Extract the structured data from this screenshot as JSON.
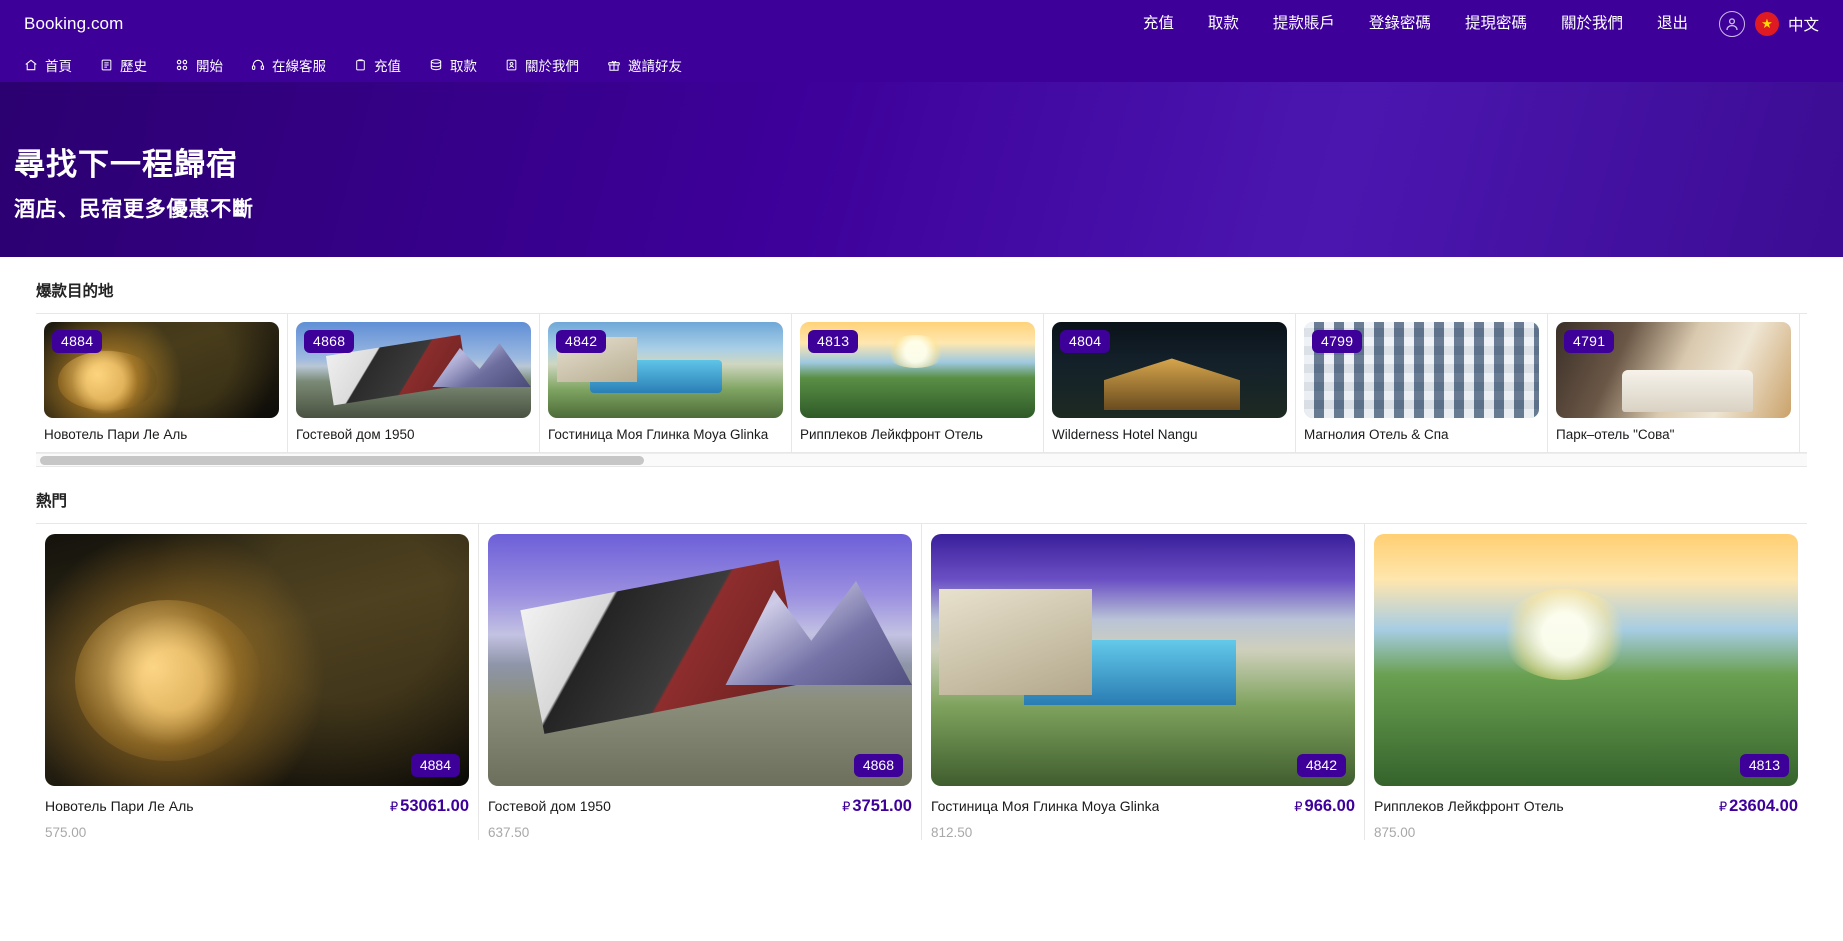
{
  "topbar": {
    "brand": "Booking.com",
    "nav": [
      {
        "label": "充值"
      },
      {
        "label": "取款"
      },
      {
        "label": "提款賬戶"
      },
      {
        "label": "登錄密碼"
      },
      {
        "label": "提現密碼"
      },
      {
        "label": "關於我們"
      },
      {
        "label": "退出"
      }
    ],
    "account_icon": "user-avatar-icon",
    "language": {
      "label": "中文",
      "flag_icon": "china-flag-icon",
      "flag_color": "#e01a22"
    }
  },
  "subnav": {
    "items": [
      {
        "label": "首頁",
        "icon": "home-icon"
      },
      {
        "label": "歷史",
        "icon": "list-icon"
      },
      {
        "label": "開始",
        "icon": "grid-icon"
      },
      {
        "label": "在線客服",
        "icon": "headset-icon"
      },
      {
        "label": "充值",
        "icon": "clipboard-icon"
      },
      {
        "label": "取款",
        "icon": "database-icon"
      },
      {
        "label": "關於我們",
        "icon": "id-card-icon"
      },
      {
        "label": "邀請好友",
        "icon": "gift-icon"
      }
    ]
  },
  "hero": {
    "title": "尋找下一程歸宿",
    "subtitle": "酒店、民宿更多優惠不斷"
  },
  "destinations": {
    "title": "爆款目的地",
    "items": [
      {
        "badge": "4884",
        "name": "Новотель Пари Ле Аль",
        "art": "ph-dome"
      },
      {
        "badge": "4868",
        "name": "Гостевой дом 1950",
        "art": "ph-house"
      },
      {
        "badge": "4842",
        "name": "Гостиница Моя Глинка Moya Glinka",
        "art": "ph-pool"
      },
      {
        "badge": "4813",
        "name": "Рипплеков Лейкфронт Отель",
        "art": "ph-lake"
      },
      {
        "badge": "4804",
        "name": "Wilderness Hotel Nangu",
        "art": "ph-cabin"
      },
      {
        "badge": "4799",
        "name": "Магнолия Отель & Спа",
        "art": "ph-tower"
      },
      {
        "badge": "4791",
        "name": "Парк–отель \"Сова\"",
        "art": "ph-room"
      }
    ]
  },
  "hot": {
    "title": "熱門",
    "currency": "₽",
    "items": [
      {
        "badge": "4884",
        "name": "Новотель Пари Ле Аль",
        "price": "53061.00",
        "sub": "575.00",
        "art": "ph-dome-big"
      },
      {
        "badge": "4868",
        "name": "Гостевой дом 1950",
        "price": "3751.00",
        "sub": "637.50",
        "art": "ph-house-big"
      },
      {
        "badge": "4842",
        "name": "Гостиница Моя Глинка Moya Glinka",
        "price": "966.00",
        "sub": "812.50",
        "art": "ph-pool-big"
      },
      {
        "badge": "4813",
        "name": "Рипплеков Лейкфронт Отель",
        "price": "23604.00",
        "sub": "875.00",
        "art": "ph-lake-big"
      }
    ]
  },
  "colors": {
    "brand_purple": "#3d0099",
    "accent_price": "#3d0099",
    "badge_bg": "#3d0099"
  }
}
